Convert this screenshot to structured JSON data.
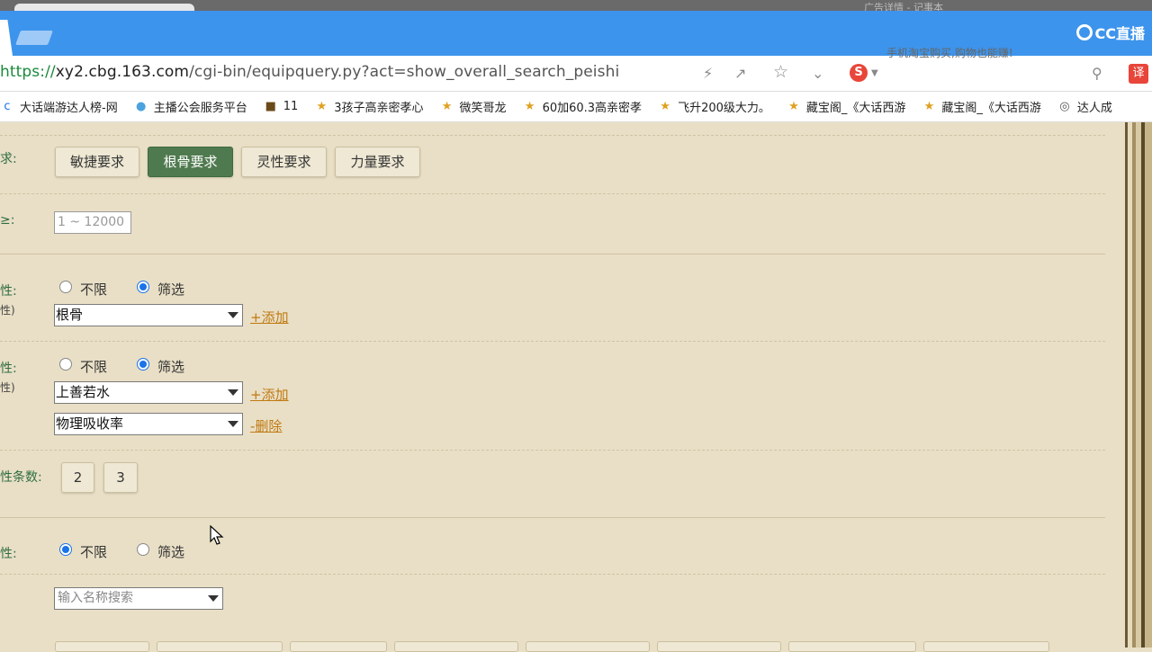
{
  "browser": {
    "ad_text": "手机淘宝购买,购物也能赚!",
    "ghost_title": "广告详情 - 记事本",
    "url_scheme": "https://",
    "url_host": "xy2.cbg.163.com",
    "url_path": "/cgi-bin/equipquery.py?act=show_overall_search_peishi",
    "translate_label": "译",
    "sogou_label": "S",
    "watermark": "CC直播"
  },
  "bookmarks": [
    {
      "icon": "c",
      "label": "大话端游达人榜-网"
    },
    {
      "icon": "●",
      "label": "主播公会服务平台"
    },
    {
      "icon": "■",
      "label": "11"
    },
    {
      "icon": "★",
      "label": "3孩子高亲密孝心"
    },
    {
      "icon": "★",
      "label": "微笑哥龙"
    },
    {
      "icon": "★",
      "label": "60加60.3高亲密孝"
    },
    {
      "icon": "★",
      "label": "飞升200级大力。"
    },
    {
      "icon": "★",
      "label": "藏宝阁_《大话西游"
    },
    {
      "icon": "★",
      "label": "藏宝阁_《大话西游"
    },
    {
      "icon": "◎",
      "label": "达人成"
    }
  ],
  "form": {
    "req_label": "求:",
    "req_buttons": [
      "敏捷要求",
      "根骨要求",
      "灵性要求",
      "力量要求"
    ],
    "ge_label": "≥:",
    "range_placeholder": "1 ~ 12000",
    "attr1_label": "性:",
    "attr1_sub": "性)",
    "attr1_options": [
      "不限",
      "筛选"
    ],
    "attr1_select": "根骨",
    "add_link": "+添加",
    "attr2_label": "性:",
    "attr2_sub": "性)",
    "attr2_options": [
      "不限",
      "筛选"
    ],
    "attr2_select1": "上善若水",
    "attr2_select2": "物理吸收率",
    "delete_link": "-删除",
    "count_label": "性条数:",
    "count_buttons": [
      "2",
      "3"
    ],
    "attr3_label": "性:",
    "attr3_options": [
      "不限",
      "筛选"
    ],
    "search_placeholder": "输入名称搜索"
  }
}
